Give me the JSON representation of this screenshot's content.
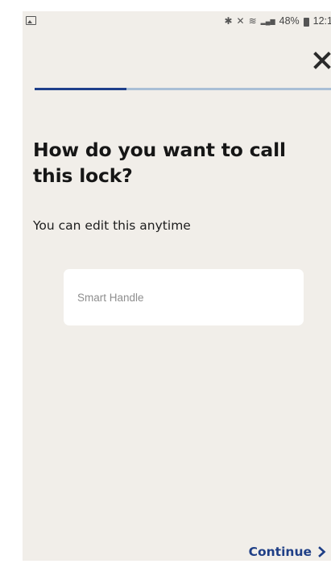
{
  "status_bar": {
    "bluetooth_icon": "✱",
    "mute_icon": "✕",
    "wifi_icon": "≋",
    "signal_icon": "▂▄▆",
    "battery": "48%",
    "time": "12:1"
  },
  "progress": {
    "fraction": 0.31,
    "fill_color": "#1e3f8a",
    "track_color": "#a9bfd6"
  },
  "close": {
    "icon": "close-icon"
  },
  "page": {
    "title": "How do you want to call this lock?",
    "subtitle": "You can edit this anytime"
  },
  "name_input": {
    "value": "",
    "placeholder": "Smart Handle"
  },
  "footer": {
    "continue_label": "Continue",
    "continue_icon": "chevron-right-icon"
  },
  "colors": {
    "background": "#f1eee9",
    "accent": "#1f3f86"
  }
}
